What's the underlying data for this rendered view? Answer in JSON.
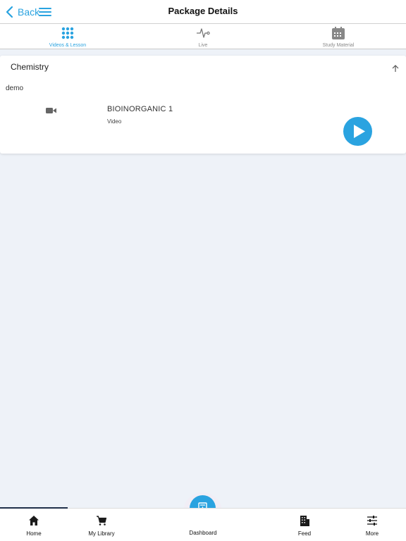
{
  "header": {
    "back_label": "Back",
    "title": "Package Details"
  },
  "tabs": [
    {
      "label": "Videos & Lesson",
      "icon": "grid-dots-icon",
      "active": true
    },
    {
      "label": "Live",
      "icon": "pulse-icon",
      "active": false
    },
    {
      "label": "Study Material",
      "icon": "calendar-icon",
      "active": false
    }
  ],
  "section": {
    "title": "Chemistry",
    "group_label": "demo",
    "items": [
      {
        "title": "BIOINORGANIC 1",
        "type": "Video",
        "icon": "video-camera-icon"
      }
    ]
  },
  "bottom_nav": {
    "items": [
      {
        "label": "Home",
        "icon": "home-icon",
        "active": true
      },
      {
        "label": "My Library",
        "icon": "cart-icon",
        "active": false
      },
      {
        "label": "Dashboard",
        "icon": "document-icon",
        "active": false
      },
      {
        "label": "Feed",
        "icon": "building-icon",
        "active": false
      },
      {
        "label": "More",
        "icon": "sliders-icon",
        "active": false
      }
    ]
  },
  "colors": {
    "accent": "#2aa3e0",
    "background": "#eef2f8",
    "active_indicator": "#20304a"
  }
}
